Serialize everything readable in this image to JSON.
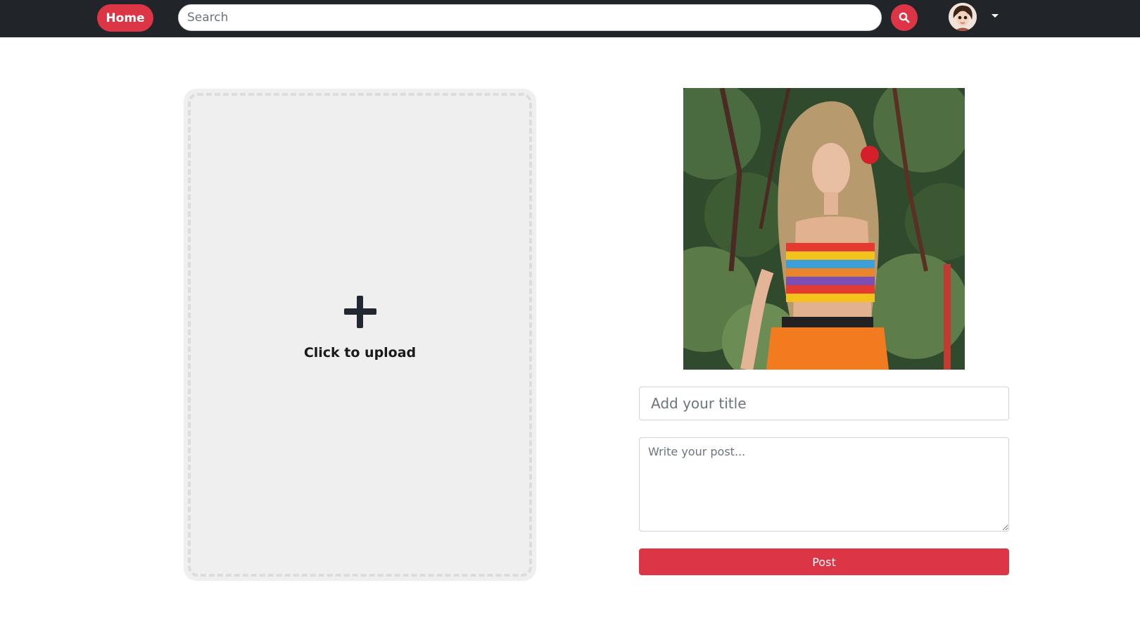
{
  "navbar": {
    "home_label": "Home",
    "search_placeholder": "Search",
    "search_icon": "search-icon",
    "avatar_icon": "user-avatar",
    "dropdown_icon": "caret-down-icon"
  },
  "upload": {
    "icon": "plus-icon",
    "label": "Click to upload"
  },
  "form": {
    "title_placeholder": "Add your title",
    "body_placeholder": "Write your post...",
    "submit_label": "Post"
  },
  "colors": {
    "brand_red": "#dc3545",
    "navbar_bg": "#212529",
    "upload_bg": "#efefef"
  }
}
